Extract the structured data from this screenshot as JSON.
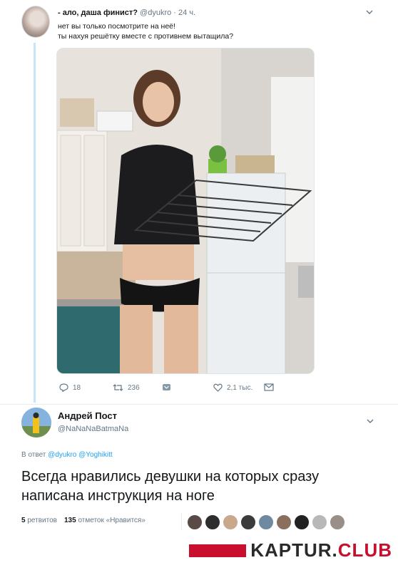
{
  "tweet1": {
    "display_name": "- ало, даша финист?",
    "handle": "@dyukro",
    "time": "24 ч.",
    "text_line1": "нет вы только посмотрите на неё!",
    "text_line2": "ты нахуя решётку вместе с противнем вытащила?",
    "replies": "18",
    "retweets": "236",
    "likes": "2,1 тыс.",
    "icons": [
      "reply-icon",
      "retweet-icon",
      "direct-message-icon",
      "like-icon",
      "envelope-icon",
      "chevron-down-icon"
    ]
  },
  "tweet2": {
    "display_name": "Андрей Пост",
    "handle": "@NaNaNaBatmaNa",
    "reply_prefix": "В ответ",
    "reply_to1": "@dyukro",
    "reply_to2": "@Yoghikitt",
    "text": "Всегда нравились девушки на которых сразу написана инструкция на ноге",
    "retweet_count": "5",
    "retweet_label": "ретвитов",
    "like_count": "135",
    "like_label": "отметок «Нравится»",
    "liker_colors": [
      "#5a4a45",
      "#2d2d2d",
      "#c9a88c",
      "#3b3b3b",
      "#6f8aa0",
      "#8a6f5e",
      "#222222",
      "#b8b8b8",
      "#9a8f88"
    ]
  },
  "colors": {
    "accent": "#1da1f2",
    "thread_line": "#c4e6f7",
    "muted": "#657786",
    "watermark": "#c8102e"
  },
  "watermark": {
    "word1": "KAPTUR.",
    "word2": "CLUB"
  }
}
